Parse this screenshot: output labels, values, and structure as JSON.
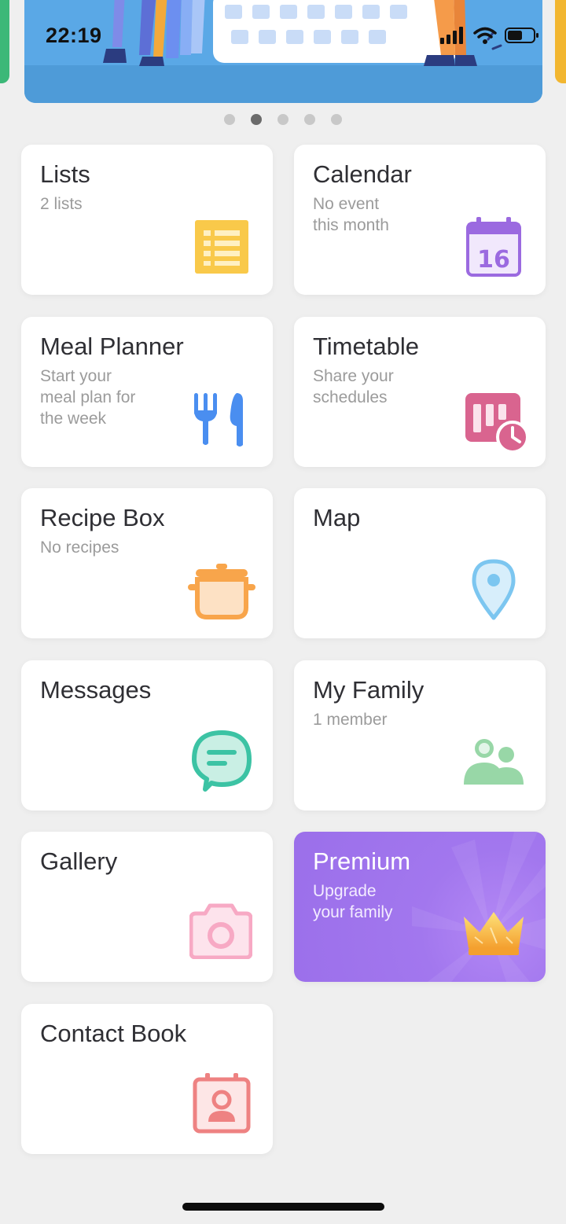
{
  "status_bar": {
    "time": "22:19",
    "icons": [
      "signal-icon",
      "wifi-icon",
      "battery-icon"
    ]
  },
  "carousel": {
    "page_count": 5,
    "active_index": 1
  },
  "cards": {
    "lists": {
      "title": "Lists",
      "subtitle": "2 lists",
      "icon": "list-icon",
      "icon_color": "#f9c94a"
    },
    "calendar": {
      "title": "Calendar",
      "subtitle": "No event\nthis month",
      "icon": "calendar-icon",
      "icon_label": "16",
      "icon_color": "#9b6ae0"
    },
    "meal_planner": {
      "title": "Meal Planner",
      "subtitle": "Start your\nmeal plan for\nthe week",
      "icon": "fork-knife-icon",
      "icon_color": "#4a8ef0"
    },
    "timetable": {
      "title": "Timetable",
      "subtitle": "Share your\nschedules",
      "icon": "timetable-clock-icon",
      "icon_color": "#d9648f"
    },
    "recipe_box": {
      "title": "Recipe Box",
      "subtitle": "No recipes",
      "icon": "cooking-pot-icon",
      "icon_color": "#f8a54b"
    },
    "map": {
      "title": "Map",
      "subtitle": "",
      "icon": "map-pin-icon",
      "icon_color": "#7cc6f0"
    },
    "messages": {
      "title": "Messages",
      "subtitle": "",
      "icon": "chat-bubble-icon",
      "icon_color": "#3cc3a4"
    },
    "my_family": {
      "title": "My Family",
      "subtitle": "1 member",
      "icon": "people-icon",
      "icon_color": "#98d7a7"
    },
    "gallery": {
      "title": "Gallery",
      "subtitle": "",
      "icon": "camera-icon",
      "icon_color": "#f7a9c4"
    },
    "premium": {
      "title": "Premium",
      "subtitle": "Upgrade\nyour family",
      "icon": "crown-icon",
      "icon_color": "#f7c945"
    },
    "contact_book": {
      "title": "Contact Book",
      "subtitle": "",
      "icon": "contact-card-icon",
      "icon_color": "#ee8282"
    }
  }
}
